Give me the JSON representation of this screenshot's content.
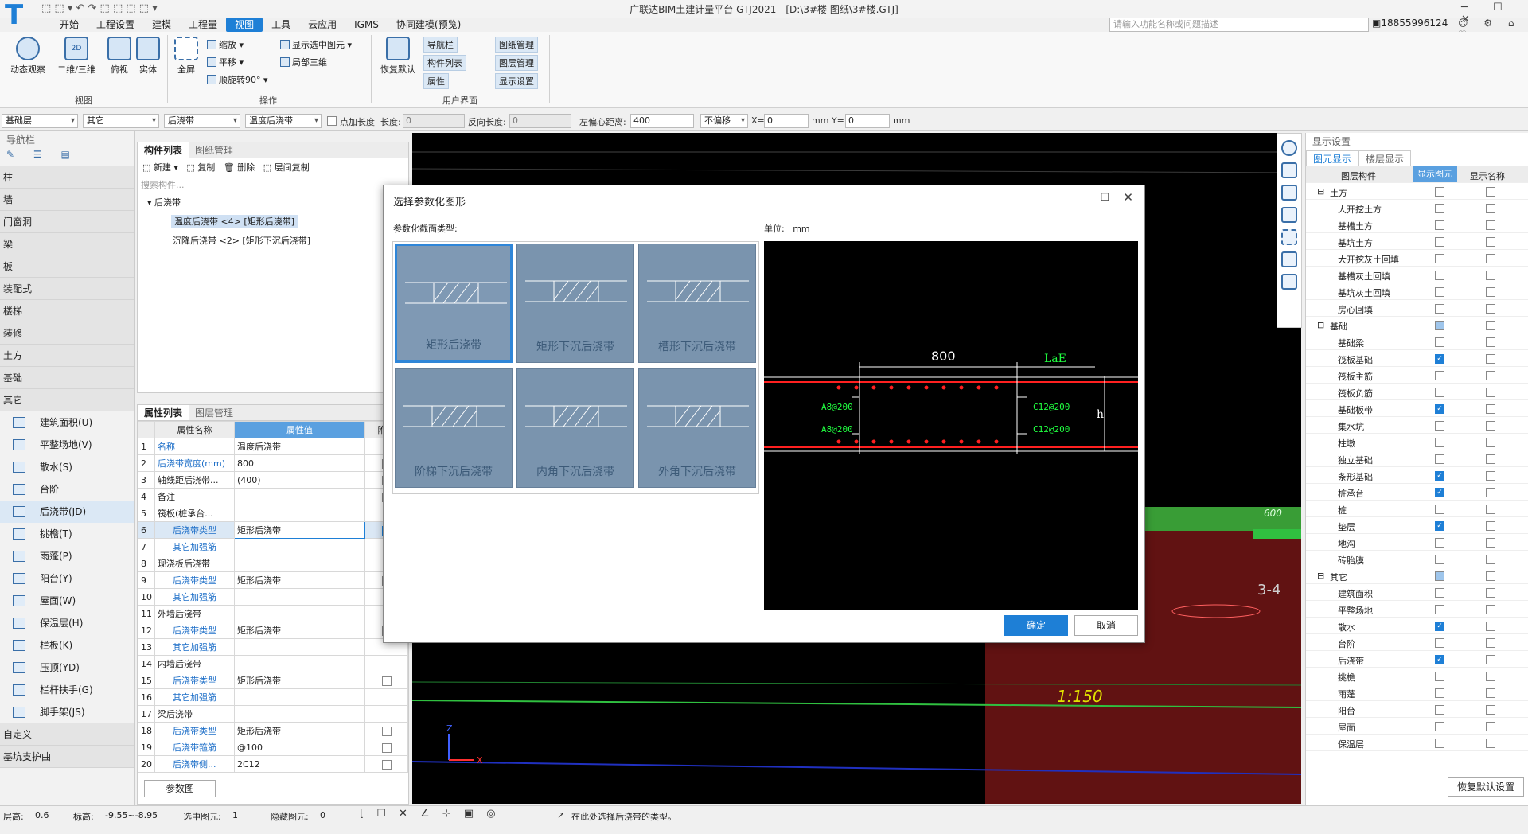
{
  "window": {
    "title": "广联达BIM土建计量平台 GTJ2021 - [D:\\3#楼 图纸\\3#楼.GTJ]"
  },
  "menu": [
    "开始",
    "工程设置",
    "建模",
    "工程量",
    "视图",
    "工具",
    "云应用",
    "IGMS",
    "协同建模(预览)"
  ],
  "menu_active": "视图",
  "search": {
    "placeholder": "请输入功能名称或问题描述"
  },
  "user": {
    "phone": "18855996124"
  },
  "ribbon": {
    "view_group": {
      "label": "视图",
      "items": [
        "动态观察",
        "二维/三维",
        "俯视",
        "实体"
      ]
    },
    "op_group": {
      "label": "操作",
      "fullscreen": "全屏",
      "small": [
        "缩放",
        "平移",
        "顺旋转90°",
        "显示选中图元",
        "局部三维"
      ]
    },
    "ui_group": {
      "label": "用户界面",
      "restore": "恢复默认",
      "buttons": [
        "导航栏",
        "图纸管理",
        "构件列表",
        "图层管理",
        "属性",
        "显示设置"
      ]
    }
  },
  "toolbar2": {
    "floor": "基础层",
    "type": "其它",
    "comp": "后浇带",
    "sub": "温度后浇带",
    "point_len_label": "点加长度",
    "length_label": "长度:",
    "length_val": "0",
    "reverse_label": "反向长度:",
    "reverse_val": "0",
    "offset_label": "左偏心距离:",
    "offset_val": "400",
    "offset_mode": "不偏移",
    "x_label": "X=",
    "x_val": "0",
    "mm1": "mm Y=",
    "y_val": "0",
    "mm2": "mm"
  },
  "nav": {
    "title": "导航栏",
    "items": [
      "柱",
      "墙",
      "门窗洞",
      "梁",
      "板",
      "装配式",
      "楼梯",
      "装修",
      "土方",
      "基础",
      "其它"
    ],
    "sub": [
      "建筑面积(U)",
      "平整场地(V)",
      "散水(S)",
      "台阶",
      "后浇带(JD)",
      "挑檐(T)",
      "雨蓬(P)",
      "阳台(Y)",
      "屋面(W)",
      "保温层(H)",
      "栏板(K)",
      "压顶(YD)",
      "栏杆扶手(G)",
      "脚手架(JS)"
    ],
    "selected": "后浇带(JD)",
    "bottom": [
      "自定义",
      "基坑支护曲"
    ]
  },
  "complist": {
    "tabs": [
      "构件列表",
      "图纸管理"
    ],
    "actions": [
      "新建",
      "复制",
      "删除",
      "层间复制"
    ],
    "search_placeholder": "搜索构件...",
    "tree_root": "后浇带",
    "items": [
      "温度后浇带 <4> [矩形后浇带]",
      "沉降后浇带 <2> [矩形下沉后浇带]"
    ]
  },
  "proplist": {
    "tabs": [
      "属性列表",
      "图层管理"
    ],
    "headers": [
      "属性名称",
      "属性值",
      "附加"
    ],
    "rows": [
      {
        "n": "1",
        "name": "名称",
        "val": "温度后浇带",
        "blue": true,
        "cb": "none"
      },
      {
        "n": "2",
        "name": "后浇带宽度(mm)",
        "val": "800",
        "blue": true,
        "cb": "off"
      },
      {
        "n": "3",
        "name": "轴线距后浇带...",
        "val": "(400)",
        "blue": false,
        "cb": "off"
      },
      {
        "n": "4",
        "name": "备注",
        "val": "",
        "blue": false,
        "cb": "off"
      },
      {
        "n": "5",
        "name": "筏板(桩承台...",
        "val": "",
        "blue": false,
        "cb": "none"
      },
      {
        "n": "6",
        "name": "后浇带类型",
        "val": "矩形后浇带",
        "blue": true,
        "cb": "on"
      },
      {
        "n": "7",
        "name": "其它加强筋",
        "val": "",
        "blue": true,
        "cb": "none"
      },
      {
        "n": "8",
        "name": "现浇板后浇带",
        "val": "",
        "blue": false,
        "cb": "none"
      },
      {
        "n": "9",
        "name": "后浇带类型",
        "val": "矩形后浇带",
        "blue": true,
        "cb": "off"
      },
      {
        "n": "10",
        "name": "其它加强筋",
        "val": "",
        "blue": true,
        "cb": "none"
      },
      {
        "n": "11",
        "name": "外墙后浇带",
        "val": "",
        "blue": false,
        "cb": "none"
      },
      {
        "n": "12",
        "name": "后浇带类型",
        "val": "矩形后浇带",
        "blue": true,
        "cb": "off"
      },
      {
        "n": "13",
        "name": "其它加强筋",
        "val": "",
        "blue": true,
        "cb": "none"
      },
      {
        "n": "14",
        "name": "内墙后浇带",
        "val": "",
        "blue": false,
        "cb": "none"
      },
      {
        "n": "15",
        "name": "后浇带类型",
        "val": "矩形后浇带",
        "blue": true,
        "cb": "off"
      },
      {
        "n": "16",
        "name": "其它加强筋",
        "val": "",
        "blue": true,
        "cb": "none"
      },
      {
        "n": "17",
        "name": "梁后浇带",
        "val": "",
        "blue": false,
        "cb": "none"
      },
      {
        "n": "18",
        "name": "后浇带类型",
        "val": "矩形后浇带",
        "blue": true,
        "cb": "off"
      },
      {
        "n": "19",
        "name": "后浇带箍筋",
        "val": "@100",
        "blue": true,
        "cb": "off"
      },
      {
        "n": "20",
        "name": "后浇带侧...",
        "val": "2C12",
        "blue": true,
        "cb": "off"
      }
    ],
    "param_button": "参数图"
  },
  "viewport": {
    "scale_text": "1:150",
    "axis_label": "3-4",
    "dim": "600"
  },
  "dialog": {
    "title": "选择参数化图形",
    "type_label": "参数化截面类型:",
    "unit_label": "单位:",
    "unit": "mm",
    "shapes": [
      "矩形后浇带",
      "矩形下沉后浇带",
      "槽形下沉后浇带",
      "阶梯下沉后浇带",
      "内角下沉后浇带",
      "外角下沉后浇带"
    ],
    "selected": "矩形后浇带",
    "preview": {
      "width": "800",
      "lae": "LaE",
      "a1": "A8@200",
      "a2": "A8@200",
      "c1": "C12@200",
      "c2": "C12@200",
      "h": "h"
    },
    "ok": "确定",
    "cancel": "取消"
  },
  "display": {
    "title": "显示设置",
    "tabs": [
      "图元显示",
      "楼层显示"
    ],
    "headers": [
      "图层构件",
      "显示图元",
      "显示名称"
    ],
    "rows": [
      {
        "g": true,
        "name": "土方",
        "s": "off",
        "m": "off"
      },
      {
        "g": false,
        "name": "大开挖土方",
        "s": "off",
        "m": "off"
      },
      {
        "g": false,
        "name": "基槽土方",
        "s": "off",
        "m": "off"
      },
      {
        "g": false,
        "name": "基坑土方",
        "s": "off",
        "m": "off"
      },
      {
        "g": false,
        "name": "大开挖灰土回填",
        "s": "off",
        "m": "off"
      },
      {
        "g": false,
        "name": "基槽灰土回填",
        "s": "off",
        "m": "off"
      },
      {
        "g": false,
        "name": "基坑灰土回填",
        "s": "off",
        "m": "off"
      },
      {
        "g": false,
        "name": "房心回填",
        "s": "off",
        "m": "off"
      },
      {
        "g": true,
        "name": "基础",
        "s": "part",
        "m": "off"
      },
      {
        "g": false,
        "name": "基础梁",
        "s": "off",
        "m": "off"
      },
      {
        "g": false,
        "name": "筏板基础",
        "s": "on",
        "m": "off"
      },
      {
        "g": false,
        "name": "筏板主筋",
        "s": "off",
        "m": "off"
      },
      {
        "g": false,
        "name": "筏板负筋",
        "s": "off",
        "m": "off"
      },
      {
        "g": false,
        "name": "基础板带",
        "s": "on",
        "m": "off"
      },
      {
        "g": false,
        "name": "集水坑",
        "s": "off",
        "m": "off"
      },
      {
        "g": false,
        "name": "柱墩",
        "s": "off",
        "m": "off"
      },
      {
        "g": false,
        "name": "独立基础",
        "s": "off",
        "m": "off"
      },
      {
        "g": false,
        "name": "条形基础",
        "s": "on",
        "m": "off"
      },
      {
        "g": false,
        "name": "桩承台",
        "s": "on",
        "m": "off"
      },
      {
        "g": false,
        "name": "桩",
        "s": "off",
        "m": "off"
      },
      {
        "g": false,
        "name": "垫层",
        "s": "on",
        "m": "off"
      },
      {
        "g": false,
        "name": "地沟",
        "s": "off",
        "m": "off"
      },
      {
        "g": false,
        "name": "砖胎膜",
        "s": "off",
        "m": "off"
      },
      {
        "g": true,
        "name": "其它",
        "s": "part",
        "m": "off"
      },
      {
        "g": false,
        "name": "建筑面积",
        "s": "off",
        "m": "off"
      },
      {
        "g": false,
        "name": "平整场地",
        "s": "off",
        "m": "off"
      },
      {
        "g": false,
        "name": "散水",
        "s": "on",
        "m": "off"
      },
      {
        "g": false,
        "name": "台阶",
        "s": "off",
        "m": "off"
      },
      {
        "g": false,
        "name": "后浇带",
        "s": "on",
        "m": "off"
      },
      {
        "g": false,
        "name": "挑檐",
        "s": "off",
        "m": "off"
      },
      {
        "g": false,
        "name": "雨蓬",
        "s": "off",
        "m": "off"
      },
      {
        "g": false,
        "name": "阳台",
        "s": "off",
        "m": "off"
      },
      {
        "g": false,
        "name": "屋面",
        "s": "off",
        "m": "off"
      },
      {
        "g": false,
        "name": "保温层",
        "s": "off",
        "m": "off"
      }
    ],
    "restore": "恢复默认设置"
  },
  "status": {
    "floor_h": "层高:",
    "floor_h_val": "0.6",
    "elev": "标高:",
    "elev_val": "-9.55~-8.95",
    "sel": "选中图元:",
    "sel_val": "1",
    "hidden": "隐藏图元:",
    "hidden_val": "0",
    "hint": "在此处选择后浇带的类型。"
  },
  "colors": {
    "accent": "#1e7fd6",
    "dialog_tile": "#7a94ae",
    "rebar": "#ff2020",
    "label_green": "#20ff40"
  }
}
